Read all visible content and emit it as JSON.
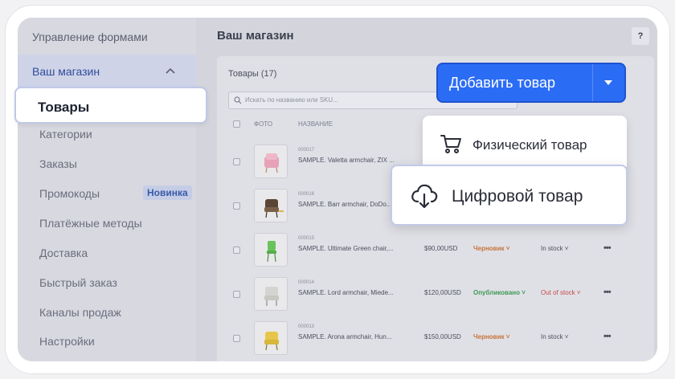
{
  "sidebar": {
    "title": "Управление формами",
    "section": "Ваш магазин",
    "active_item": "Товары",
    "items": [
      "Категории",
      "Заказы",
      "Промокоды",
      "Платёжные методы",
      "Доставка",
      "Быстрый заказ",
      "Каналы продаж",
      "Настройки"
    ],
    "badge": "Новинка"
  },
  "main": {
    "title": "Ваш магазин",
    "help": "?",
    "panel_title": "Товары (17)",
    "search_placeholder": "Искать по названию или SKU...",
    "columns": {
      "photo": "ФОТО",
      "name": "НАЗВАНИЕ"
    },
    "rows": [
      {
        "sku": "000017",
        "name": "SAMPLE. Valetta armchair, ZIX ...",
        "price": "",
        "status": "",
        "stock": ""
      },
      {
        "sku": "000016",
        "name": "SAMPLE. Barr armchair, DoDo...",
        "price": "",
        "status": "",
        "stock": ""
      },
      {
        "sku": "000015",
        "name": "SAMPLE. Ultimate Green chair,...",
        "price": "$90,00USD",
        "status": "Черновик ˅",
        "stock": "In stock ˅"
      },
      {
        "sku": "000014",
        "name": "SAMPLE. Lord armchair, Miede...",
        "price": "$120,00USD",
        "status": "Опубликовано ˅",
        "stock": "Out of stock ˅"
      },
      {
        "sku": "000013",
        "name": "SAMPLE. Arona armchair, Hun...",
        "price": "$150,00USD",
        "status": "Черновик ˅",
        "stock": "In stock ˅"
      }
    ],
    "more": "•••"
  },
  "add_button": {
    "label": "Добавить товар"
  },
  "dropdown": {
    "physical": "Физический товар",
    "digital": "Цифровой товар"
  },
  "colors": {
    "primary": "#2b6cf5",
    "draft": "#c8733a",
    "published": "#3f9a54",
    "out_of_stock": "#c84a4a"
  }
}
